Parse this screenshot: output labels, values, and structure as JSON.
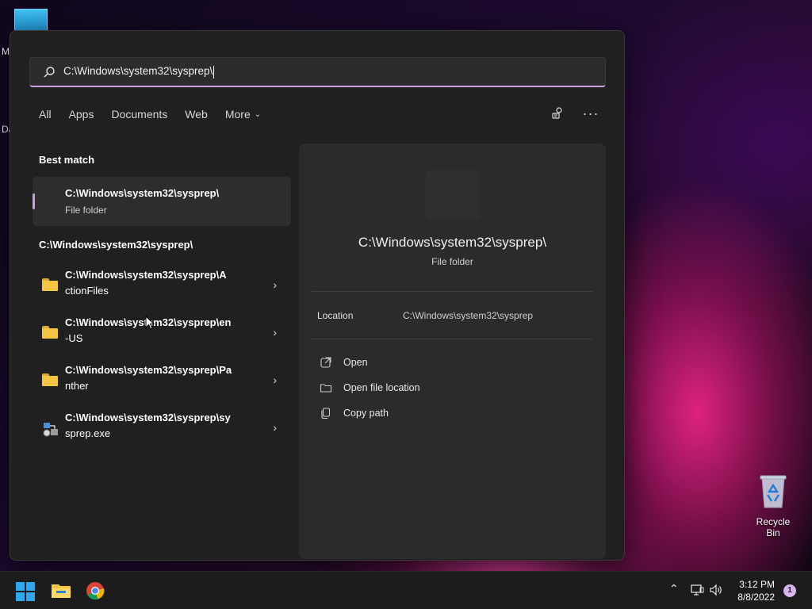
{
  "desktop": {
    "letters": [
      "M",
      "Da"
    ],
    "recycle_bin_label": "Recycle Bin"
  },
  "search": {
    "value": "C:\\Windows\\system32\\sysprep\\"
  },
  "tabs": [
    "All",
    "Apps",
    "Documents",
    "Web",
    "More"
  ],
  "best_match": {
    "label": "Best match",
    "name": "C:\\Windows\\system32\\sysprep\\",
    "type": "File folder"
  },
  "results_group": {
    "label": "C:\\Windows\\system32\\sysprep\\",
    "items": [
      {
        "line1": "C:\\Windows\\system32\\sysprep\\A",
        "line2": "ctionFiles",
        "icon": "folder-icon"
      },
      {
        "line1": "C:\\Windows\\system32\\sysprep\\en",
        "line2": "-US",
        "icon": "folder-icon"
      },
      {
        "line1": "C:\\Windows\\system32\\sysprep\\Pa",
        "line2": "nther",
        "icon": "folder-icon"
      },
      {
        "line1": "C:\\Windows\\system32\\sysprep\\sy",
        "line2": "sprep.exe",
        "icon": "sysprep-app-icon"
      }
    ]
  },
  "preview": {
    "title": "C:\\Windows\\system32\\sysprep\\",
    "subtitle": "File folder",
    "location_label": "Location",
    "location_value": "C:\\Windows\\system32\\sysprep",
    "actions": [
      "Open",
      "Open file location",
      "Copy path"
    ]
  },
  "taskbar": {
    "time": "3:12 PM",
    "date": "8/8/2022",
    "notification_count": "1"
  },
  "colors": {
    "accent": "#c9a0dc",
    "panel_bg": "#202020",
    "folder_yellow": "#f4c542"
  }
}
